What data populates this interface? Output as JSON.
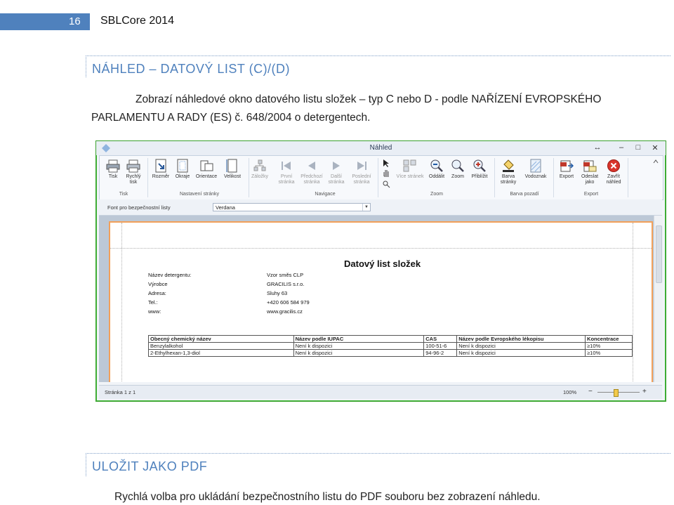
{
  "header": {
    "page_number": "16",
    "book_title": "SBLCore 2014"
  },
  "section1": {
    "heading": "NÁHLED – DATOVÝ LIST (C)/(D)",
    "para_line1": "Zobrazí náhledové okno datového listu složek – typ C nebo D - podle NAŘÍZENÍ EVROPSKÉHO",
    "para_line2": "PARLAMENTU A RADY (ES) č. 648/2004 o detergentech."
  },
  "window": {
    "title": "Náhled",
    "controls": {
      "resize": "↔",
      "minimize": "–",
      "maximize": "□",
      "close": "✕"
    },
    "ribbon": {
      "buttons": {
        "tisk": "Tisk",
        "rychly_tisk": "Rychlý tisk",
        "rozmer": "Rozměr",
        "okraje": "Okraje",
        "orientace": "Orientace",
        "velikost": "Velikost",
        "zalozky": "Záložky",
        "prvni": "První stránka",
        "predchozi": "Předchozí stránka",
        "dalsi": "Další stránka",
        "posledni": "Poslední stránka",
        "vice_stranek": "Více stránek",
        "oddalit": "Oddálit",
        "zoom": "Zoom",
        "priblizit": "Přiblížit",
        "barva_stranky": "Barva stránky",
        "vodoznak": "Vodoznak",
        "export": "Export",
        "odeslat_jako": "Odeslat jako",
        "zavrit_nahled": "Zavřít náhled"
      },
      "groups": {
        "tisk": "Tisk",
        "nastaveni": "Nastavení stránky",
        "navigace": "Navigace",
        "zoom": "Zoom",
        "barva_pozadi": "Barva pozadí",
        "export": "Export"
      }
    },
    "font_bar": {
      "label": "Font pro bezpečnostní listy",
      "selected": "Verdana"
    },
    "document": {
      "title": "Datový list složek",
      "fields": [
        {
          "label": "Název detergentu:",
          "value": "Vzor směs CLP"
        },
        {
          "label": "Výrobce",
          "value": "GRACILIS s.r.o."
        },
        {
          "label": "Adresa:",
          "value": "Sluhy 63"
        },
        {
          "label": "Tel.:",
          "value": "+420 606 584 979"
        },
        {
          "label": "www:",
          "value": "www.gracilis.cz"
        }
      ],
      "table": {
        "headers": [
          "Obecný chemický název",
          "Název podle IUPAC",
          "CAS",
          "Název podle Evropského lékopisu",
          "Koncentrace"
        ],
        "rows": [
          [
            "Benzylalkohol",
            "Není k dispozici",
            "100-51-6",
            "Není k dispozici",
            "≥10%"
          ],
          [
            "2-Ethylhexan-1,3-diol",
            "Není k dispozici",
            "94-96-2",
            "Není k dispozici",
            "≥10%"
          ]
        ]
      }
    },
    "status": {
      "page": "Stránka 1 z 1",
      "zoom": "100%",
      "zoom_minus": "−",
      "zoom_plus": "+"
    }
  },
  "section2": {
    "heading": "ULOŽIT JAKO PDF",
    "para": "Rychlá volba pro ukládání bezpečnostního listu do PDF souboru bez zobrazení náhledu."
  }
}
